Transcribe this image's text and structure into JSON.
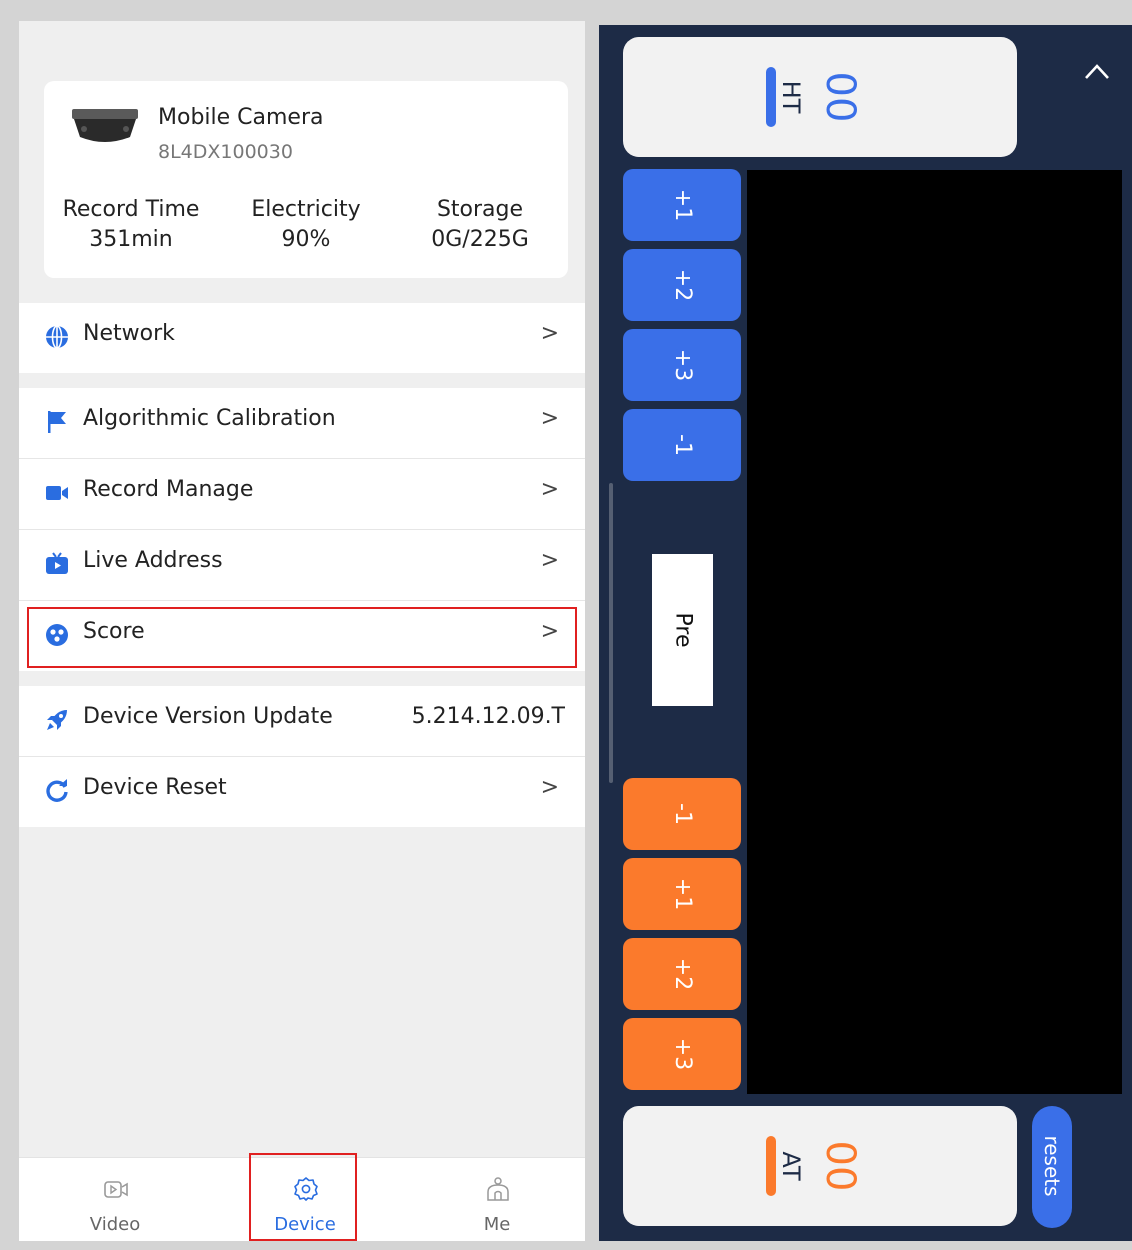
{
  "device": {
    "name": "Mobile Camera",
    "serial": "8L4DX100030",
    "stats": [
      {
        "label": "Record Time",
        "value": "351min"
      },
      {
        "label": "Electricity",
        "value": "90%"
      },
      {
        "label": "Storage",
        "value": "0G/225G"
      }
    ]
  },
  "menu": {
    "network": {
      "label": "Network",
      "icon": "globe-icon",
      "chevron": ">"
    },
    "calibration": {
      "label": "Algorithmic Calibration",
      "icon": "flag-icon",
      "chevron": ">"
    },
    "record": {
      "label": "Record Manage",
      "icon": "video-camera-icon",
      "chevron": ">"
    },
    "live": {
      "label": "Live Address",
      "icon": "tv-icon",
      "chevron": ">"
    },
    "score": {
      "label": "Score",
      "icon": "score-icon",
      "chevron": ">"
    },
    "update": {
      "label": "Device Version Update",
      "icon": "rocket-icon",
      "value": "5.214.12.09.T"
    },
    "reset": {
      "label": "Device Reset",
      "icon": "refresh-icon",
      "chevron": ">"
    }
  },
  "tabs": [
    {
      "label": "Video",
      "icon": "video-icon",
      "active": false
    },
    {
      "label": "Device",
      "icon": "gear-icon",
      "active": true
    },
    {
      "label": "Me",
      "icon": "person-icon",
      "active": false
    }
  ],
  "scoreboard": {
    "home": {
      "score": "00",
      "label": "HT",
      "color": "#3a6fe8"
    },
    "away": {
      "score": "00",
      "label": "AT",
      "color": "#fb7a2c"
    },
    "home_buttons": [
      "+1",
      "+2",
      "+3",
      "-1"
    ],
    "away_buttons": [
      "-1",
      "+1",
      "+2",
      "+3"
    ],
    "pre_label": "Pre",
    "resets_label": "resets",
    "collapse_icon": "chevron-up-icon"
  },
  "colors": {
    "accent": "#2a6de0",
    "highlight": "#e02020",
    "panel_bg": "#1d2b46",
    "home": "#3a6fe8",
    "away": "#fb7a2c"
  }
}
